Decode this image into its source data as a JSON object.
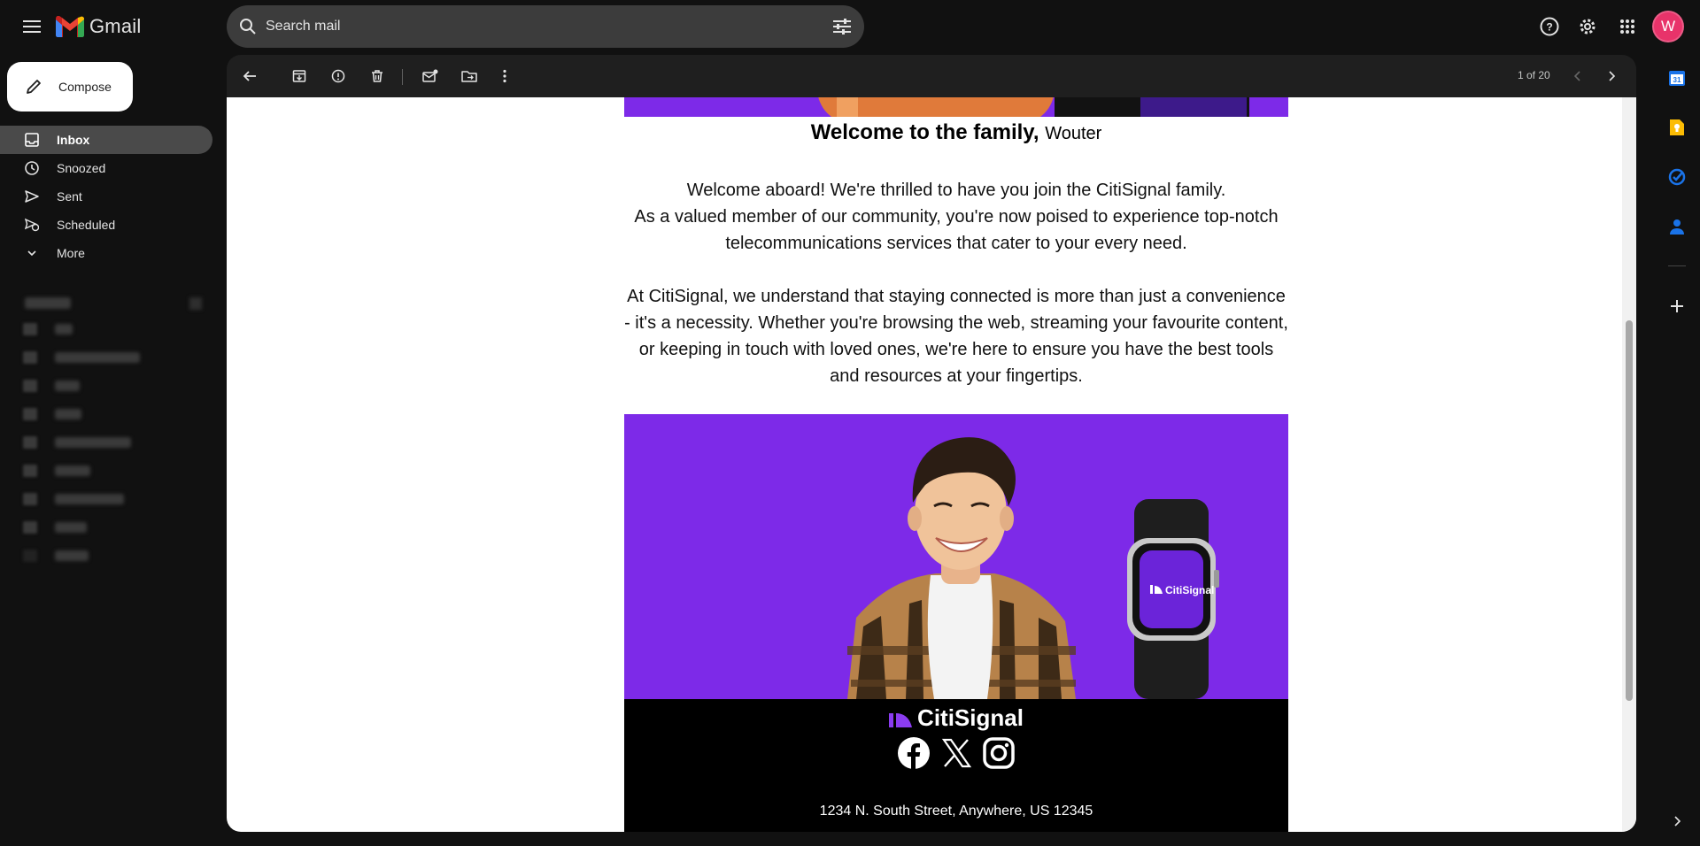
{
  "app": {
    "name": "Gmail"
  },
  "search": {
    "placeholder": "Search mail"
  },
  "account": {
    "initial": "W"
  },
  "compose": {
    "label": "Compose"
  },
  "nav": {
    "items": [
      {
        "label": "Inbox",
        "icon": "inbox-icon",
        "active": true
      },
      {
        "label": "Snoozed",
        "icon": "clock-icon"
      },
      {
        "label": "Sent",
        "icon": "send-icon"
      },
      {
        "label": "Scheduled",
        "icon": "scheduled-icon"
      },
      {
        "label": "More",
        "icon": "chevron-down-icon"
      }
    ]
  },
  "toolbar": {
    "pager": "1 of 20"
  },
  "email": {
    "title": "Welcome to the family,",
    "name": "Wouter",
    "p1_line1": "Welcome aboard! We're thrilled to have you join the CitiSignal family.",
    "p1_line2": "As a valued member of our community, you're now poised to experience top-notch telecommunications services that cater to your every need.",
    "p2": "At CitiSignal, we understand that staying connected is more than just a convenience - it's a necessity. Whether you're browsing the web, streaming your favourite content, or keeping in touch with loved ones, we're here to ensure you have the best tools and resources at your fingertips.",
    "watch_brand": "CitiSignal",
    "footer_brand": "CitiSignal",
    "address": "1234 N. South Street, Anywhere, US 12345"
  },
  "colors": {
    "brand_purple": "#7d2ae8",
    "avatar": "#e8336a",
    "gmail_red": "#ea4335"
  }
}
